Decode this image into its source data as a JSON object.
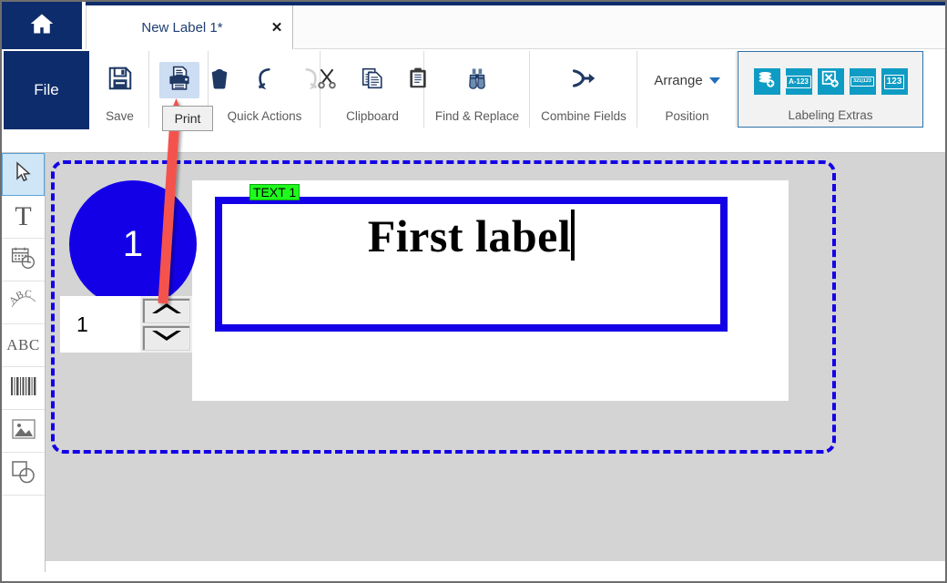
{
  "window": {
    "home_icon": "home-icon"
  },
  "tab": {
    "title": "New Label 1*",
    "close": "✕"
  },
  "ribbon": {
    "file_label": "File",
    "groups": [
      {
        "label": "Save",
        "buttons": [
          {
            "name": "save-icon",
            "state": "normal"
          }
        ]
      },
      {
        "label": "Print",
        "buttons": [
          {
            "name": "print-icon",
            "state": "highlighted"
          }
        ]
      },
      {
        "label": "Quick Actions",
        "buttons": [
          {
            "name": "delete-trash-icon",
            "state": "normal"
          },
          {
            "name": "undo-icon",
            "state": "normal"
          },
          {
            "name": "redo-icon",
            "state": "disabled"
          }
        ]
      },
      {
        "label": "Clipboard",
        "buttons": [
          {
            "name": "cut-scissors-icon",
            "state": "normal"
          },
          {
            "name": "copy-icon",
            "state": "normal"
          },
          {
            "name": "paste-icon",
            "state": "normal"
          }
        ]
      },
      {
        "label": "Find & Replace",
        "buttons": [
          {
            "name": "binoculars-icon",
            "state": "normal"
          }
        ]
      },
      {
        "label": "Combine Fields",
        "buttons": [
          {
            "name": "merge-arrow-icon",
            "state": "normal"
          }
        ]
      },
      {
        "label": "Position",
        "arrange_label": "Arrange",
        "arrange_caret": "chevron-down-icon"
      }
    ],
    "labeling_extras": {
      "label": "Labeling Extras",
      "buttons": [
        {
          "name": "database-add-icon",
          "text": ""
        },
        {
          "name": "serialize-alphanumeric-icon",
          "text": "A-123"
        },
        {
          "name": "variable-field-icon",
          "text": ""
        },
        {
          "name": "counter-range-icon",
          "text": "321|123"
        },
        {
          "name": "numbering-icon",
          "text": "123"
        }
      ]
    }
  },
  "toolbar": {
    "items": [
      {
        "name": "select-pointer-tool",
        "glyph": "pointer",
        "selected": true
      },
      {
        "name": "text-tool",
        "glyph": "T",
        "selected": false
      },
      {
        "name": "datetime-tool",
        "glyph": "calendar-clock",
        "selected": false
      },
      {
        "name": "curved-text-tool",
        "glyph": "ABC-arc",
        "selected": false
      },
      {
        "name": "paragraph-text-tool",
        "glyph": "ABC",
        "selected": false
      },
      {
        "name": "barcode-tool",
        "glyph": "barcode",
        "selected": false
      },
      {
        "name": "image-tool",
        "glyph": "picture",
        "selected": false
      },
      {
        "name": "shape-tool",
        "glyph": "shapes",
        "selected": false
      }
    ]
  },
  "canvas": {
    "label_object": {
      "tag": "TEXT 1",
      "text": "First label",
      "cursor_visible": true
    },
    "circle_badge": {
      "value": "1",
      "color": "#1400e6"
    },
    "copies_spinner": {
      "value": "1",
      "up": "spinner-up-icon",
      "down": "spinner-down-icon"
    }
  },
  "annotation": {
    "tooltip": "Print",
    "arrow_color": "#f4524d"
  },
  "colors": {
    "brand_navy": "#0d2c6b",
    "accent_blue": "#1400e6",
    "extras_teal": "#0f9cc4",
    "tag_green": "#1dfb1d",
    "canvas_gray": "#d4d4d4"
  }
}
